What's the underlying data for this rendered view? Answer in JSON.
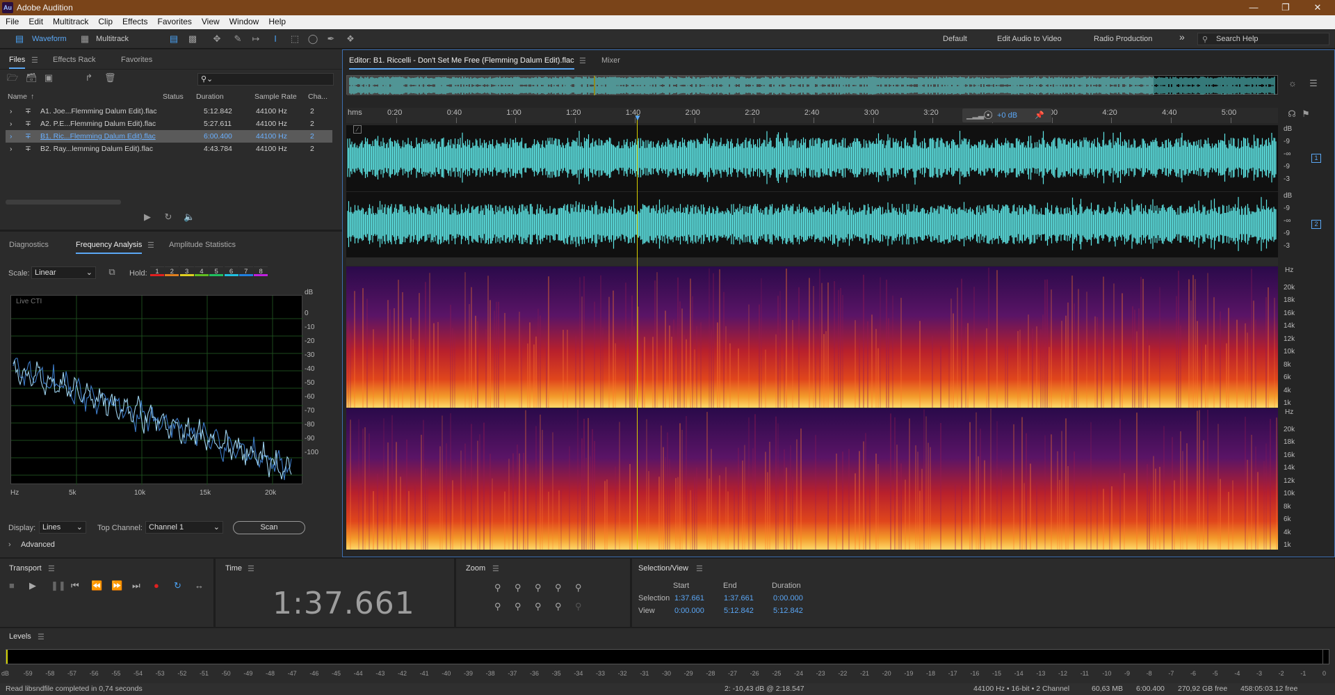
{
  "app": {
    "title": "Adobe Audition",
    "logo": "Au"
  },
  "menu": [
    "File",
    "Edit",
    "Multitrack",
    "Clip",
    "Effects",
    "Favorites",
    "View",
    "Window",
    "Help"
  ],
  "toolbar": {
    "waveform": "Waveform",
    "multitrack": "Multitrack",
    "workspaces": [
      "Default",
      "Edit Audio to Video",
      "Radio Production"
    ],
    "search_placeholder": "Search Help"
  },
  "files_panel": {
    "tabs": [
      "Files",
      "Effects Rack",
      "Favorites"
    ],
    "search_placeholder": "",
    "columns": [
      "Name",
      "Status",
      "Duration",
      "Sample Rate",
      "Cha..."
    ],
    "rows": [
      {
        "name": "A1. Joe...Flemming Dalum Edit).flac",
        "duration": "5:12.842",
        "rate": "44100 Hz",
        "ch": "2"
      },
      {
        "name": "A2. P.E...Flemming Dalum Edit).flac",
        "duration": "5:27.611",
        "rate": "44100 Hz",
        "ch": "2"
      },
      {
        "name": "B1. Ric...Flemming Dalum Edit).flac",
        "duration": "6:00.400",
        "rate": "44100 Hz",
        "ch": "2"
      },
      {
        "name": "B2. Ray...lemming Dalum Edit).flac",
        "duration": "4:43.784",
        "rate": "44100 Hz",
        "ch": "2"
      }
    ],
    "selected_row": 2
  },
  "analysis": {
    "tabs": [
      "Diagnostics",
      "Frequency Analysis",
      "Amplitude Statistics"
    ],
    "scale_label": "Scale:",
    "scale_value": "Linear",
    "hold_label": "Hold:",
    "hold_buttons": [
      "1",
      "2",
      "3",
      "4",
      "5",
      "6",
      "7",
      "8"
    ],
    "hold_colors": [
      "#e02020",
      "#e08020",
      "#e0d020",
      "#60c020",
      "#20c060",
      "#20c0e0",
      "#2080e0",
      "#c020e0"
    ],
    "graph_label": "Live CTI",
    "db_ticks": [
      "dB",
      "0",
      "-10",
      "-20",
      "-30",
      "-40",
      "-50",
      "-60",
      "-70",
      "-80",
      "-90",
      "-100"
    ],
    "hz_ticks": [
      "Hz",
      "5k",
      "10k",
      "15k",
      "20k"
    ],
    "display_label": "Display:",
    "display_value": "Lines",
    "top_channel_label": "Top Channel:",
    "top_channel_value": "Channel 1",
    "scan": "Scan",
    "advanced": "Advanced"
  },
  "editor": {
    "tab": "Editor: B1. Riccelli - Don't Set Me Free (Flemming Dalum Edit).flac",
    "mixer": "Mixer",
    "ruler_unit": "hms",
    "ruler": [
      "0:20",
      "0:40",
      "1:00",
      "1:20",
      "1:40",
      "2:00",
      "2:20",
      "2:40",
      "3:00",
      "3:20",
      "3:40",
      "4:00",
      "4:20",
      "4:40",
      "5:00"
    ],
    "gain": "+0 dB",
    "wave_db": [
      "dB",
      "-9",
      "-∞",
      "-9",
      "-3"
    ],
    "channels": [
      "1",
      "2"
    ],
    "spec_hz": [
      "Hz",
      "20k",
      "18k",
      "16k",
      "14k",
      "12k",
      "10k",
      "8k",
      "6k",
      "4k",
      "1k"
    ]
  },
  "transport": {
    "title": "Transport"
  },
  "time": {
    "title": "Time",
    "value": "1:37.661"
  },
  "zoom": {
    "title": "Zoom"
  },
  "selection": {
    "title": "Selection/View",
    "headers": [
      "Start",
      "End",
      "Duration"
    ],
    "rows": [
      {
        "label": "Selection",
        "start": "1:37.661",
        "end": "1:37.661",
        "duration": "0:00.000"
      },
      {
        "label": "View",
        "start": "0:00.000",
        "end": "5:12.842",
        "duration": "5:12.842"
      }
    ]
  },
  "levels": {
    "title": "Levels",
    "ticks": [
      "dB",
      "-59",
      "-58",
      "-57",
      "-56",
      "-55",
      "-54",
      "-53",
      "-52",
      "-51",
      "-50",
      "-49",
      "-48",
      "-47",
      "-46",
      "-45",
      "-44",
      "-43",
      "-42",
      "-41",
      "-40",
      "-39",
      "-38",
      "-37",
      "-36",
      "-35",
      "-34",
      "-33",
      "-32",
      "-31",
      "-30",
      "-29",
      "-28",
      "-27",
      "-26",
      "-25",
      "-24",
      "-23",
      "-22",
      "-21",
      "-20",
      "-19",
      "-18",
      "-17",
      "-16",
      "-15",
      "-14",
      "-13",
      "-12",
      "-11",
      "-10",
      "-9",
      "-8",
      "-7",
      "-6",
      "-5",
      "-4",
      "-3",
      "-2",
      "-1",
      "0"
    ]
  },
  "status": {
    "left": "Read libsndfile completed in 0,74 seconds",
    "cursor": "2: -10,43 dB @ 2:18.547",
    "format": "44100 Hz • 16-bit • 2 Channel",
    "size": "60,63 MB",
    "duration": "6:00.400",
    "free": "270,92 GB free",
    "free_time": "458:05:03.12 free"
  },
  "colors": {
    "accent": "#5ba8f5",
    "waveform": "#5ee6e6",
    "titlebar": "#7a4419"
  }
}
